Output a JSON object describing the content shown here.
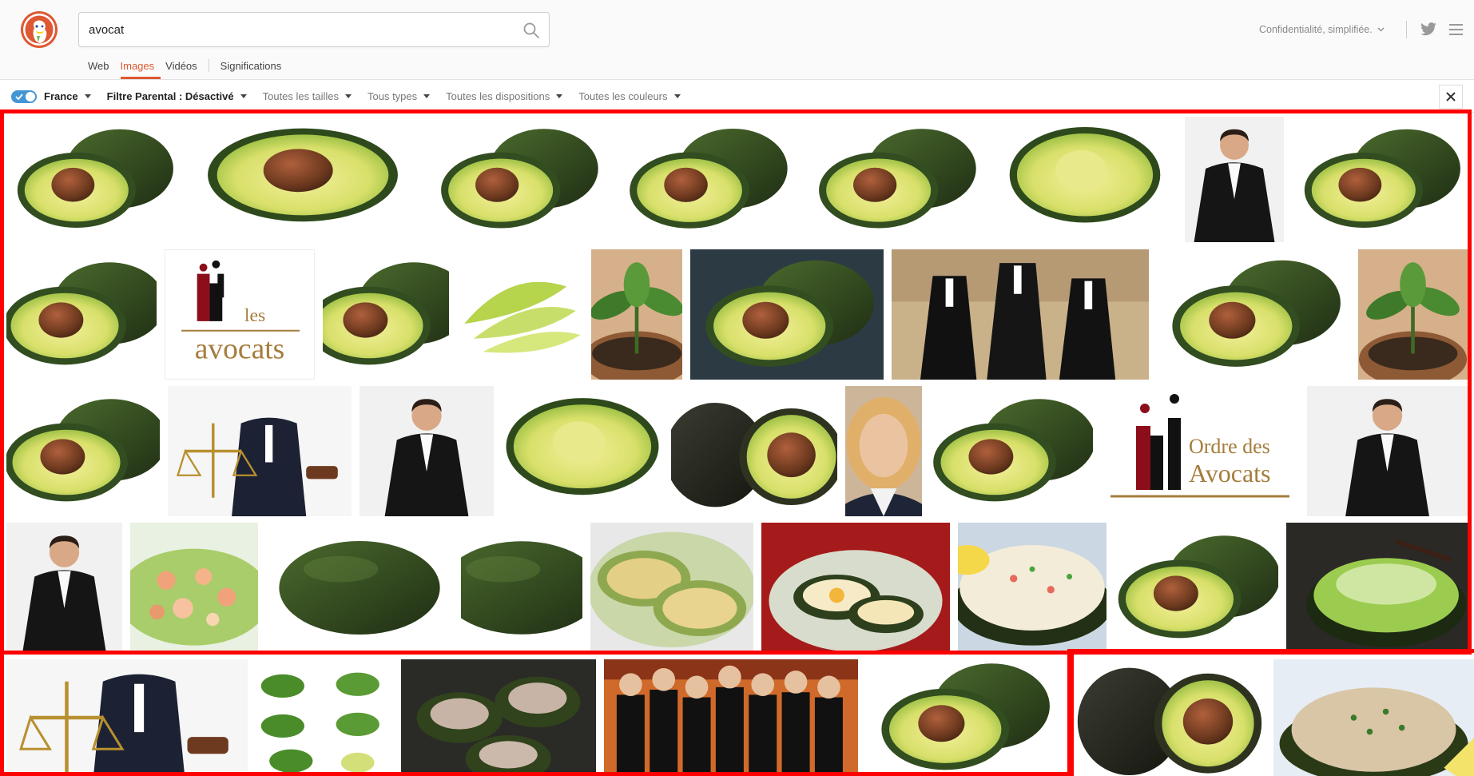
{
  "search": {
    "query": "avocat"
  },
  "nav": {
    "web": "Web",
    "images": "Images",
    "videos": "Vidéos",
    "meanings": "Significations"
  },
  "header": {
    "privacy": "Confidentialité, simplifiée."
  },
  "filters": {
    "region": "France",
    "safe_search": "Filtre Parental : Désactivé",
    "size": "Toutes les tailles",
    "type": "Tous types",
    "layout": "Toutes les dispositions",
    "color": "Toutes les couleurs"
  },
  "logos": [
    {
      "line1": "les",
      "line2": "avocats"
    },
    {
      "line1": "Ordre des",
      "line2": "Avocats"
    }
  ],
  "colors": {
    "accent": "#de5833",
    "toggle": "#4495d4",
    "highlight": "#ff0000"
  }
}
